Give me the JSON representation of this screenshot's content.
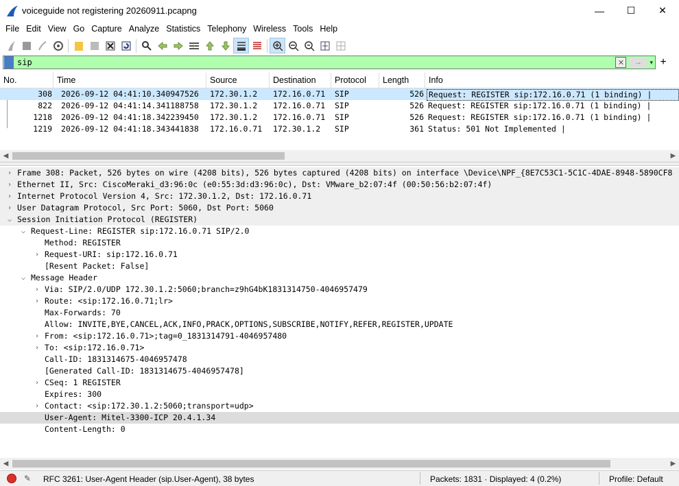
{
  "window": {
    "title": "voiceguide not registering 20260911.pcapng",
    "minimize": "—",
    "maximize": "☐",
    "close": "✕"
  },
  "menu": [
    "File",
    "Edit",
    "View",
    "Go",
    "Capture",
    "Analyze",
    "Statistics",
    "Telephony",
    "Wireless",
    "Tools",
    "Help"
  ],
  "filter": {
    "value": "sip",
    "clear_icon": "✕",
    "apply_icon": "→",
    "dropdown_icon": "▾",
    "add_icon": "+"
  },
  "packet_list": {
    "columns": [
      "No.",
      "Time",
      "Source",
      "Destination",
      "Protocol",
      "Length",
      "Info"
    ],
    "rows": [
      {
        "no": "308",
        "time": "2026-09-12 04:41:10.340947526",
        "src": "172.30.1.2",
        "dst": "172.16.0.71",
        "proto": "SIP",
        "len": "526",
        "info": "Request: REGISTER sip:172.16.0.71  (1 binding) |"
      },
      {
        "no": "822",
        "time": "2026-09-12 04:41:14.341188758",
        "src": "172.30.1.2",
        "dst": "172.16.0.71",
        "proto": "SIP",
        "len": "526",
        "info": "Request: REGISTER sip:172.16.0.71  (1 binding) |"
      },
      {
        "no": "1218",
        "time": "2026-09-12 04:41:18.342239450",
        "src": "172.30.1.2",
        "dst": "172.16.0.71",
        "proto": "SIP",
        "len": "526",
        "info": "Request: REGISTER sip:172.16.0.71  (1 binding) |"
      },
      {
        "no": "1219",
        "time": "2026-09-12 04:41:18.343441838",
        "src": "172.16.0.71",
        "dst": "172.30.1.2",
        "proto": "SIP",
        "len": "361",
        "info": "Status: 501 Not Implemented |"
      }
    ]
  },
  "details": [
    {
      "level": 0,
      "expander": ">",
      "text": "Frame 308: Packet, 526 bytes on wire (4208 bits), 526 bytes captured (4208 bits) on interface \\Device\\NPF_{8E7C53C1-5C1C-4DAE-8948-5890CF8"
    },
    {
      "level": 0,
      "expander": ">",
      "text": "Ethernet II, Src: CiscoMeraki_d3:96:0c (e0:55:3d:d3:96:0c), Dst: VMware_b2:07:4f (00:50:56:b2:07:4f)"
    },
    {
      "level": 0,
      "expander": ">",
      "text": "Internet Protocol Version 4, Src: 172.30.1.2, Dst: 172.16.0.71"
    },
    {
      "level": 0,
      "expander": ">",
      "text": "User Datagram Protocol, Src Port: 5060, Dst Port: 5060"
    },
    {
      "level": 0,
      "expander": "v",
      "text": "Session Initiation Protocol (REGISTER)"
    },
    {
      "level": 1,
      "expander": "v",
      "text": "Request-Line: REGISTER sip:172.16.0.71 SIP/2.0"
    },
    {
      "level": 2,
      "expander": "",
      "text": "Method: REGISTER"
    },
    {
      "level": 2,
      "expander": ">",
      "text": "Request-URI: sip:172.16.0.71"
    },
    {
      "level": 2,
      "expander": "",
      "text": "[Resent Packet: False]"
    },
    {
      "level": 1,
      "expander": "v",
      "text": "Message Header"
    },
    {
      "level": 2,
      "expander": ">",
      "text": "Via: SIP/2.0/UDP 172.30.1.2:5060;branch=z9hG4bK1831314750-4046957479"
    },
    {
      "level": 2,
      "expander": ">",
      "text": "Route: <sip:172.16.0.71;lr>"
    },
    {
      "level": 2,
      "expander": "",
      "text": "Max-Forwards: 70"
    },
    {
      "level": 2,
      "expander": "",
      "text": "Allow: INVITE,BYE,CANCEL,ACK,INFO,PRACK,OPTIONS,SUBSCRIBE,NOTIFY,REFER,REGISTER,UPDATE"
    },
    {
      "level": 2,
      "expander": ">",
      "text": "From: <sip:172.16.0.71>;tag=0_1831314791-4046957480"
    },
    {
      "level": 2,
      "expander": ">",
      "text": "To: <sip:172.16.0.71>"
    },
    {
      "level": 2,
      "expander": "",
      "text": "Call-ID: 1831314675-4046957478"
    },
    {
      "level": 2,
      "expander": "",
      "text": "[Generated Call-ID: 1831314675-4046957478]"
    },
    {
      "level": 2,
      "expander": ">",
      "text": "CSeq: 1 REGISTER"
    },
    {
      "level": 2,
      "expander": "",
      "text": "Expires: 300"
    },
    {
      "level": 2,
      "expander": ">",
      "text": "Contact: <sip:172.30.1.2:5060;transport=udp>"
    },
    {
      "level": 2,
      "expander": "",
      "text": "User-Agent: Mitel-3300-ICP 20.4.1.34"
    },
    {
      "level": 2,
      "expander": "",
      "text": "Content-Length: 0"
    }
  ],
  "status": {
    "field": "RFC 3261: User-Agent Header (sip.User-Agent), 38 bytes",
    "packets": "Packets: 1831 · Displayed: 4 (0.2%)",
    "profile": "Profile: Default"
  },
  "colors": {
    "filter_bg": "#afffaf",
    "selected_row": "#cce8ff",
    "record_led": "#d9312b"
  }
}
